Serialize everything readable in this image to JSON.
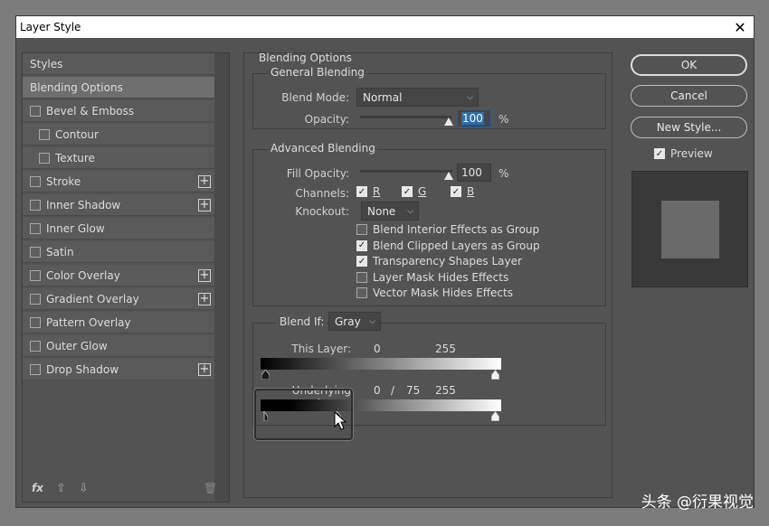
{
  "window": {
    "title": "Layer Style",
    "close_glyph": "✕"
  },
  "styles_panel": {
    "items": [
      {
        "label": "Styles",
        "checkbox": false,
        "selected": false,
        "indent": false,
        "plus": false
      },
      {
        "label": "Blending Options",
        "checkbox": false,
        "selected": true,
        "indent": false,
        "plus": false
      },
      {
        "label": "Bevel & Emboss",
        "checkbox": true,
        "checked": false,
        "indent": false,
        "plus": false
      },
      {
        "label": "Contour",
        "checkbox": true,
        "checked": false,
        "indent": true,
        "plus": false
      },
      {
        "label": "Texture",
        "checkbox": true,
        "checked": false,
        "indent": true,
        "plus": false
      },
      {
        "label": "Stroke",
        "checkbox": true,
        "checked": false,
        "indent": false,
        "plus": true
      },
      {
        "label": "Inner Shadow",
        "checkbox": true,
        "checked": false,
        "indent": false,
        "plus": true
      },
      {
        "label": "Inner Glow",
        "checkbox": true,
        "checked": false,
        "indent": false,
        "plus": false
      },
      {
        "label": "Satin",
        "checkbox": true,
        "checked": false,
        "indent": false,
        "plus": false
      },
      {
        "label": "Color Overlay",
        "checkbox": true,
        "checked": false,
        "indent": false,
        "plus": true
      },
      {
        "label": "Gradient Overlay",
        "checkbox": true,
        "checked": false,
        "indent": false,
        "plus": true
      },
      {
        "label": "Pattern Overlay",
        "checkbox": true,
        "checked": false,
        "indent": false,
        "plus": false
      },
      {
        "label": "Outer Glow",
        "checkbox": true,
        "checked": false,
        "indent": false,
        "plus": false
      },
      {
        "label": "Drop Shadow",
        "checkbox": true,
        "checked": false,
        "indent": false,
        "plus": true
      }
    ],
    "footer": {
      "fx": "fx",
      "up": "⇧",
      "down": "⇩",
      "trash": "🗑"
    }
  },
  "blending_options": {
    "title": "Blending Options",
    "general": {
      "title": "General Blending",
      "blend_mode_label": "Blend Mode:",
      "blend_mode_value": "Normal",
      "opacity_label": "Opacity:",
      "opacity_value": "100",
      "opacity_unit": "%",
      "opacity_fraction": 1.0
    },
    "advanced": {
      "title": "Advanced Blending",
      "fill_opacity_label": "Fill Opacity:",
      "fill_opacity_value": "100",
      "fill_opacity_unit": "%",
      "fill_opacity_fraction": 1.0,
      "channels_label": "Channels:",
      "channels": [
        {
          "label": "R",
          "checked": true
        },
        {
          "label": "G",
          "checked": true
        },
        {
          "label": "B",
          "checked": true
        }
      ],
      "knockout_label": "Knockout:",
      "knockout_value": "None",
      "options": [
        {
          "label": "Blend Interior Effects as Group",
          "checked": false
        },
        {
          "label": "Blend Clipped Layers as Group",
          "checked": true
        },
        {
          "label": "Transparency Shapes Layer",
          "checked": true
        },
        {
          "label": "Layer Mask Hides Effects",
          "checked": false
        },
        {
          "label": "Vector Mask Hides Effects",
          "checked": false
        }
      ]
    },
    "blend_if": {
      "label": "Blend If:",
      "value": "Gray",
      "this_layer_label": "This Layer:",
      "this_layer_low": "0",
      "this_layer_high": "255",
      "underlying_label": "Underlying Layer:",
      "underlying_low": "0",
      "underlying_sep": "/",
      "underlying_split": "75",
      "underlying_high": "255"
    }
  },
  "buttons": {
    "ok": "OK",
    "cancel": "Cancel",
    "new_style": "New Style...",
    "preview_label": "Preview",
    "preview_checked": true
  },
  "watermark": "头条 @衍果视觉"
}
